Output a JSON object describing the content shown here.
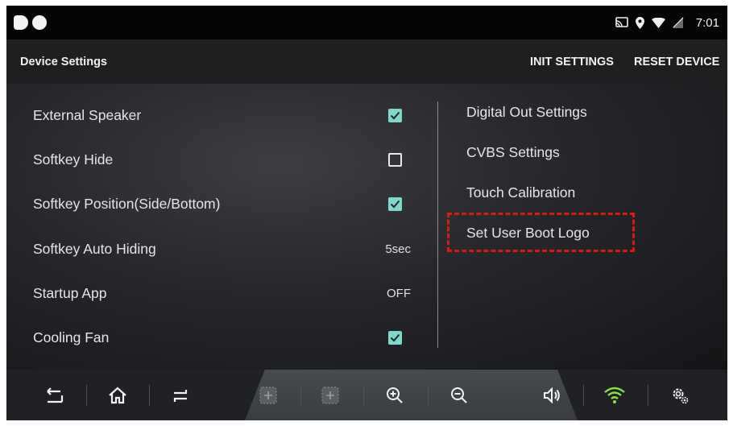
{
  "status_bar": {
    "time": "7:01",
    "icons": [
      "cast-icon",
      "location-icon",
      "wifi-icon",
      "battery-icon"
    ]
  },
  "action_bar": {
    "title": "Device Settings",
    "init_label": "INIT SETTINGS",
    "reset_label": "RESET DEVICE"
  },
  "left_settings": [
    {
      "label": "External Speaker",
      "type": "checkbox",
      "checked": true
    },
    {
      "label": "Softkey Hide",
      "type": "checkbox",
      "checked": false
    },
    {
      "label": "Softkey Position(Side/Bottom)",
      "type": "checkbox",
      "checked": true
    },
    {
      "label": "Softkey Auto Hiding",
      "type": "value",
      "value": "5sec"
    },
    {
      "label": "Startup App",
      "type": "value",
      "value": "OFF"
    },
    {
      "label": "Cooling Fan",
      "type": "checkbox",
      "checked": true
    }
  ],
  "right_settings": [
    {
      "label": "Digital Out Settings"
    },
    {
      "label": "CVBS Settings"
    },
    {
      "label": "Touch Calibration"
    },
    {
      "label": "Set User Boot Logo",
      "highlighted": true
    }
  ],
  "nav_bar": {
    "buttons": [
      "back-icon",
      "home-icon",
      "recents-icon",
      "add-window-icon",
      "add-window-icon",
      "zoom-in-icon",
      "zoom-out-icon",
      "volume-icon",
      "wifi-icon",
      "settings-icon"
    ]
  },
  "colors": {
    "checkbox_accent": "#82d6cc",
    "highlight": "#d61a1a",
    "wifi_active": "#8ee04a"
  }
}
